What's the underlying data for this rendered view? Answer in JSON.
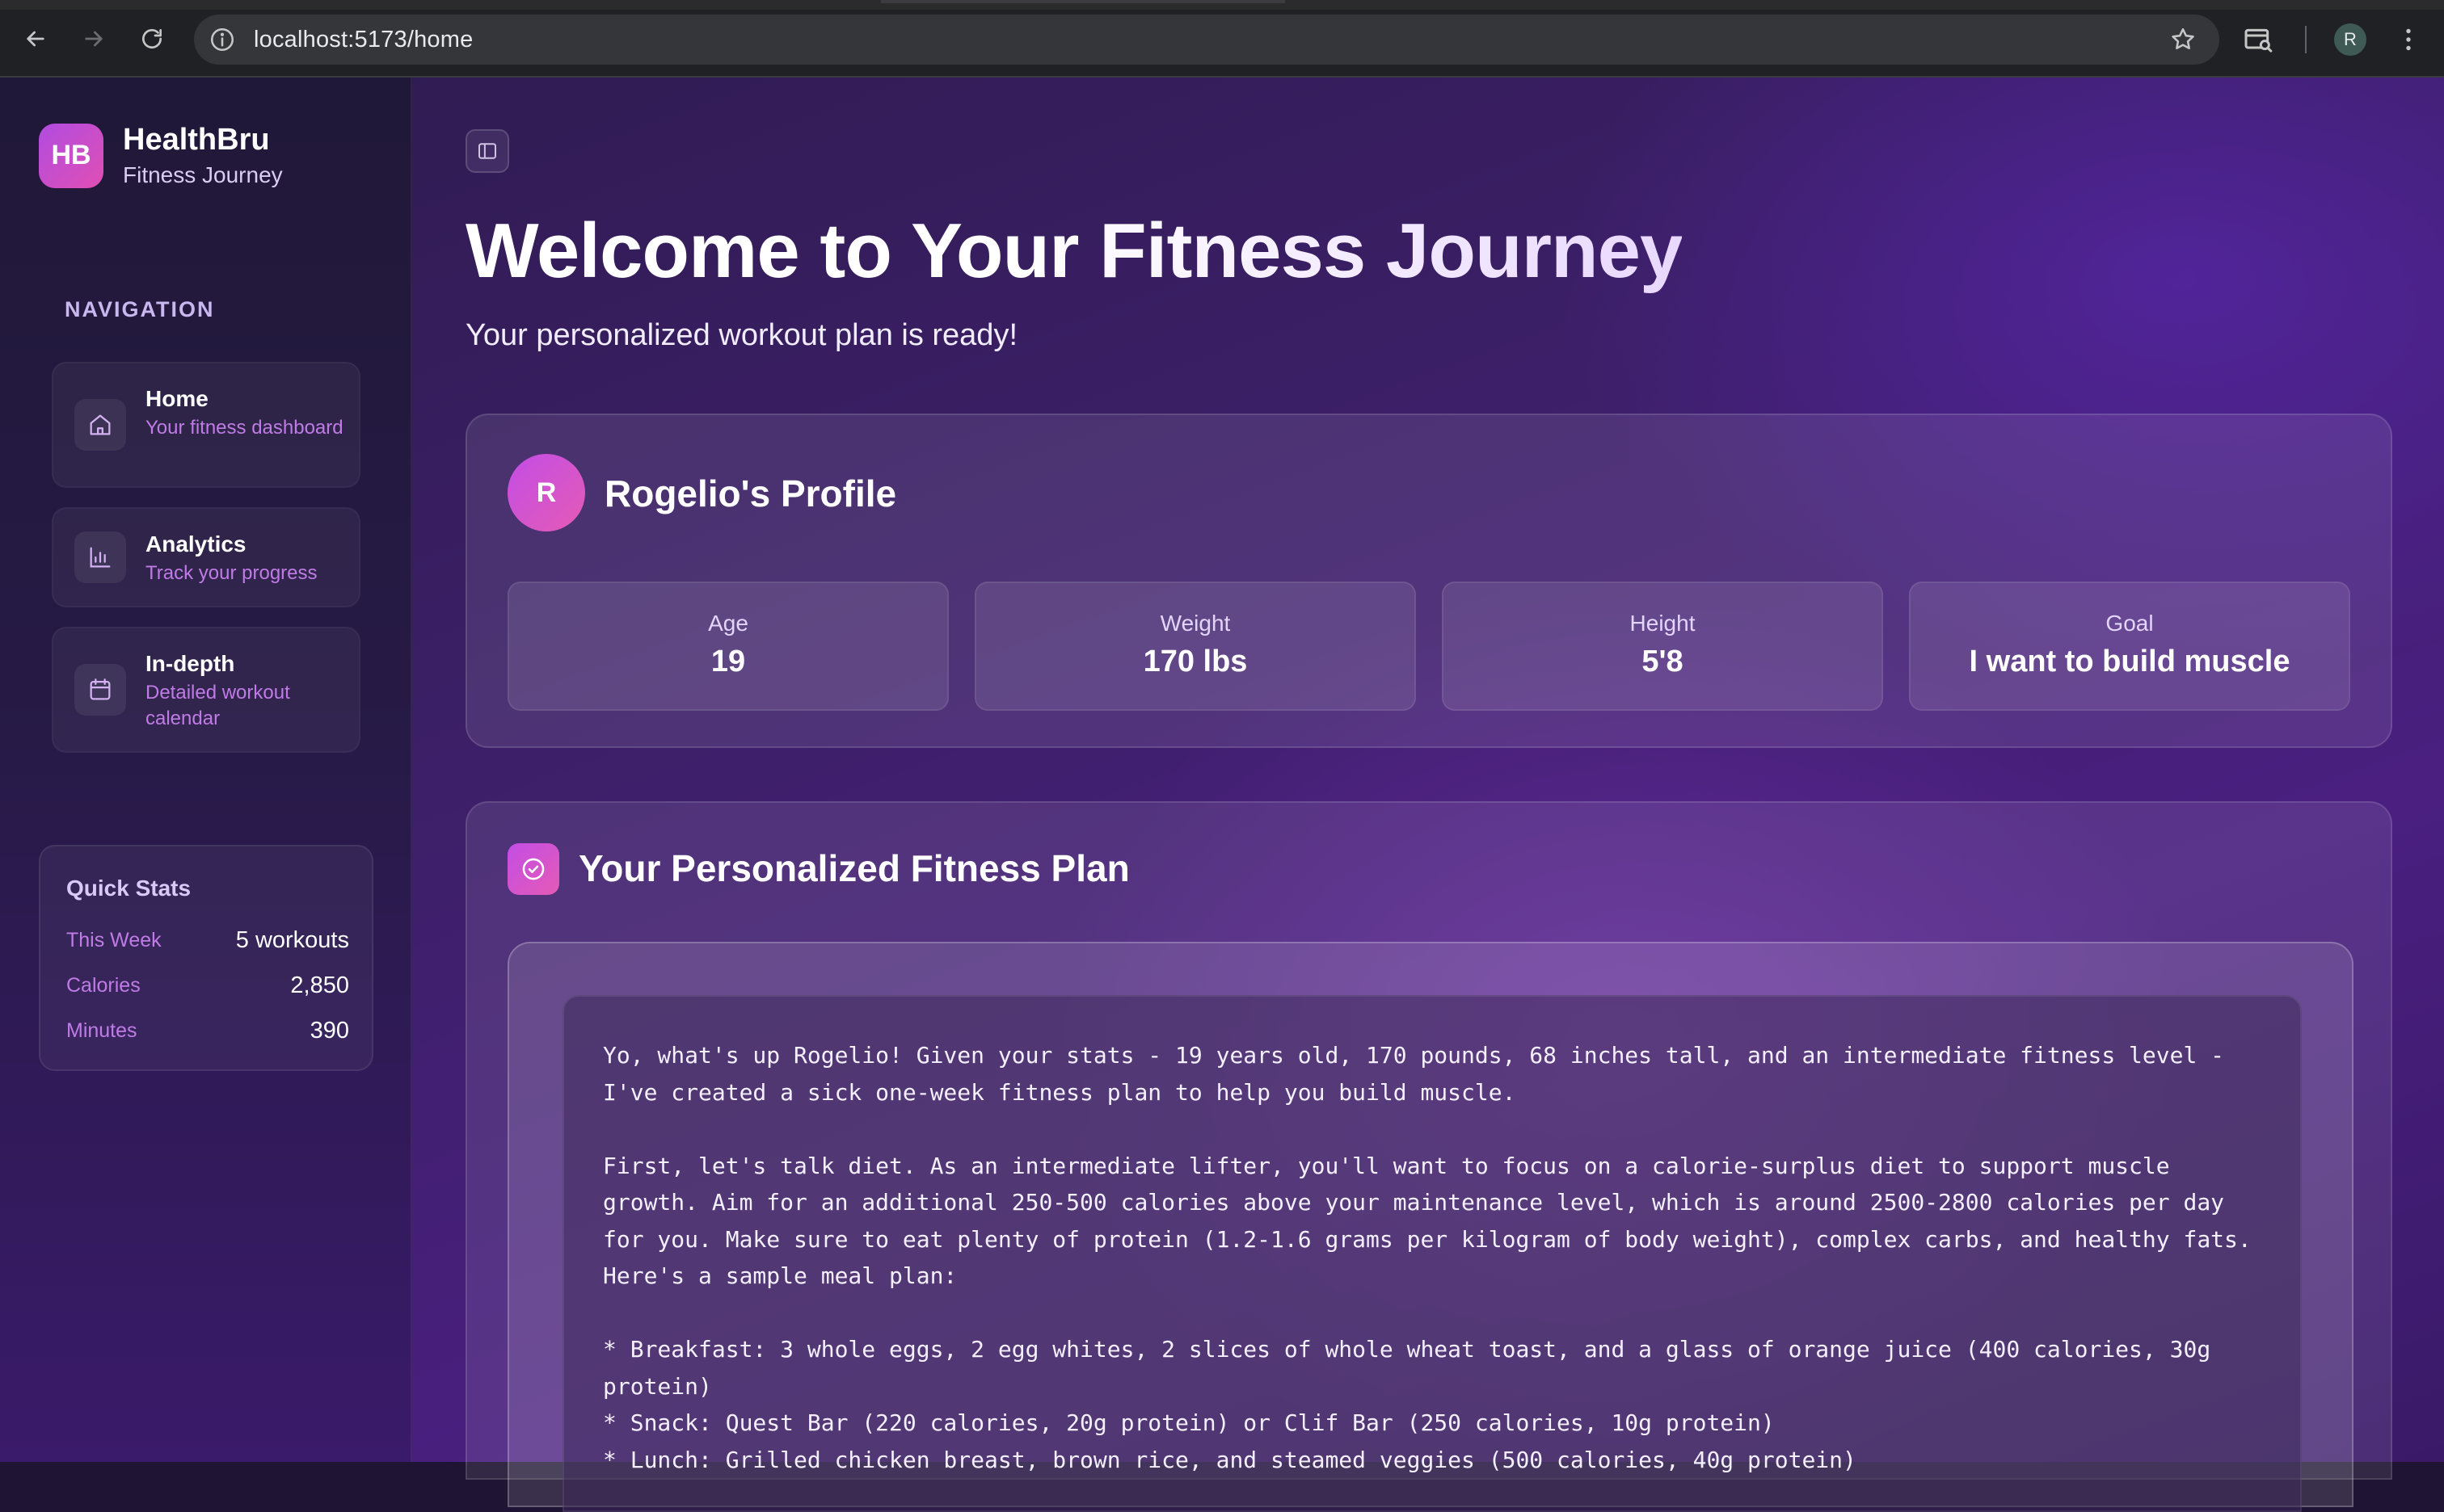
{
  "browser": {
    "url": "localhost:5173/home",
    "profile_initial": "R"
  },
  "sidebar": {
    "brand_initials": "HB",
    "brand_name": "HealthBru",
    "brand_subtitle": "Fitness Journey",
    "nav_heading": "NAVIGATION",
    "items": [
      {
        "title": "Home",
        "desc": "Your fitness dashboard",
        "icon": "home-icon"
      },
      {
        "title": "Analytics",
        "desc": "Track your progress",
        "icon": "bar-chart-icon"
      },
      {
        "title": "In-depth",
        "desc": "Detailed workout calendar",
        "icon": "calendar-icon"
      }
    ],
    "quick_stats": {
      "title": "Quick Stats",
      "rows": [
        {
          "label": "This Week",
          "value": "5 workouts"
        },
        {
          "label": "Calories",
          "value": "2,850"
        },
        {
          "label": "Minutes",
          "value": "390"
        }
      ]
    }
  },
  "main": {
    "title": "Welcome to Your Fitness Journey",
    "subtitle": "Your personalized workout plan is ready!",
    "profile": {
      "initial": "R",
      "title": "Rogelio's Profile",
      "stats": [
        {
          "label": "Age",
          "value": "19"
        },
        {
          "label": "Weight",
          "value": "170 lbs"
        },
        {
          "label": "Height",
          "value": "5'8"
        },
        {
          "label": "Goal",
          "value": "I want to build muscle"
        }
      ]
    },
    "plan": {
      "title": "Your Personalized Fitness Plan",
      "lines": [
        "Yo, what's up Rogelio! Given your stats - 19 years old, 170 pounds, 68 inches tall, and an intermediate fitness level -",
        "I've created a sick one-week fitness plan to help you build muscle.",
        "",
        "First, let's talk diet. As an intermediate lifter, you'll want to focus on a calorie-surplus diet to support muscle",
        "growth. Aim for an additional 250-500 calories above your maintenance level, which is around 2500-2800 calories per day",
        "for you. Make sure to eat plenty of protein (1.2-1.6 grams per kilogram of body weight), complex carbs, and healthy fats.",
        "Here's a sample meal plan:",
        "",
        "* Breakfast: 3 whole eggs, 2 egg whites, 2 slices of whole wheat toast, and a glass of orange juice (400 calories, 30g",
        "protein)",
        "* Snack: Quest Bar (220 calories, 20g protein) or Clif Bar (250 calories, 10g protein)",
        "* Lunch: Grilled chicken breast, brown rice, and steamed veggies (500 calories, 40g protein)"
      ]
    }
  }
}
